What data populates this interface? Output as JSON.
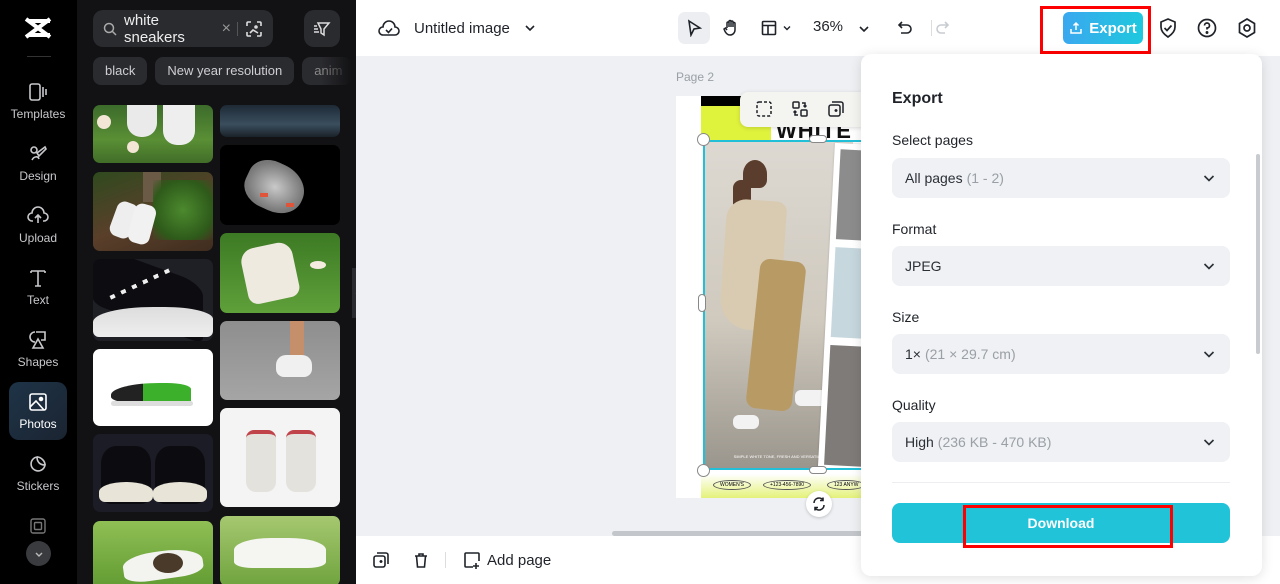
{
  "app": {
    "document_title": "Untitled image",
    "zoom_level": "36%"
  },
  "rail": {
    "items": [
      {
        "label": "Templates",
        "icon": "templates-icon"
      },
      {
        "label": "Design",
        "icon": "design-icon"
      },
      {
        "label": "Upload",
        "icon": "upload-icon"
      },
      {
        "label": "Text",
        "icon": "text-icon"
      },
      {
        "label": "Shapes",
        "icon": "shapes-icon"
      },
      {
        "label": "Photos",
        "icon": "photos-icon",
        "active": true
      },
      {
        "label": "Stickers",
        "icon": "stickers-icon"
      }
    ]
  },
  "photos_panel": {
    "search_value": "white sneakers",
    "chips": [
      "black",
      "New year resolution",
      "anim"
    ],
    "thumbnails": [
      {
        "description": "white sneakers on grass with mushrooms"
      },
      {
        "description": "dark blurred image"
      },
      {
        "description": "white slip-on sneakers by fern and tree"
      },
      {
        "description": "flying white sneaker on black"
      },
      {
        "description": "black canvas sneakers close-up"
      },
      {
        "description": "white slip-on on grass"
      },
      {
        "description": "legs walking in white sneakers"
      },
      {
        "description": "green sneaker on white background"
      },
      {
        "description": "white high-top sneakers front view"
      },
      {
        "description": "black canvas sneakers front view"
      },
      {
        "description": "white sneakers on grass"
      },
      {
        "description": "white sneakers lying on grass"
      }
    ]
  },
  "canvas": {
    "page_label": "Page 2",
    "design_texts": {
      "headline": "WHITE",
      "caption": "SIMPLE WHITE TONE, FRESH AND VERSATILE",
      "tags": [
        "WOMEN'S",
        "+123-456-7890",
        "123 ANYW"
      ]
    },
    "colors": {
      "accent_yellow": "#dff23c",
      "selection": "#22c0d8"
    }
  },
  "bottom_bar": {
    "add_page_label": "Add page"
  },
  "toolbar": {
    "export_label": "Export"
  },
  "export_panel": {
    "title": "Export",
    "fields": [
      {
        "label": "Select pages",
        "value": "All pages",
        "detail": "(1 - 2)"
      },
      {
        "label": "Format",
        "value": "JPEG",
        "detail": ""
      },
      {
        "label": "Size",
        "value": "1×",
        "detail": "(21 × 29.7 cm)"
      },
      {
        "label": "Quality",
        "value": "High",
        "detail": "(236 KB - 470 KB)"
      }
    ],
    "download_label": "Download",
    "accent": "#21c3d9"
  }
}
